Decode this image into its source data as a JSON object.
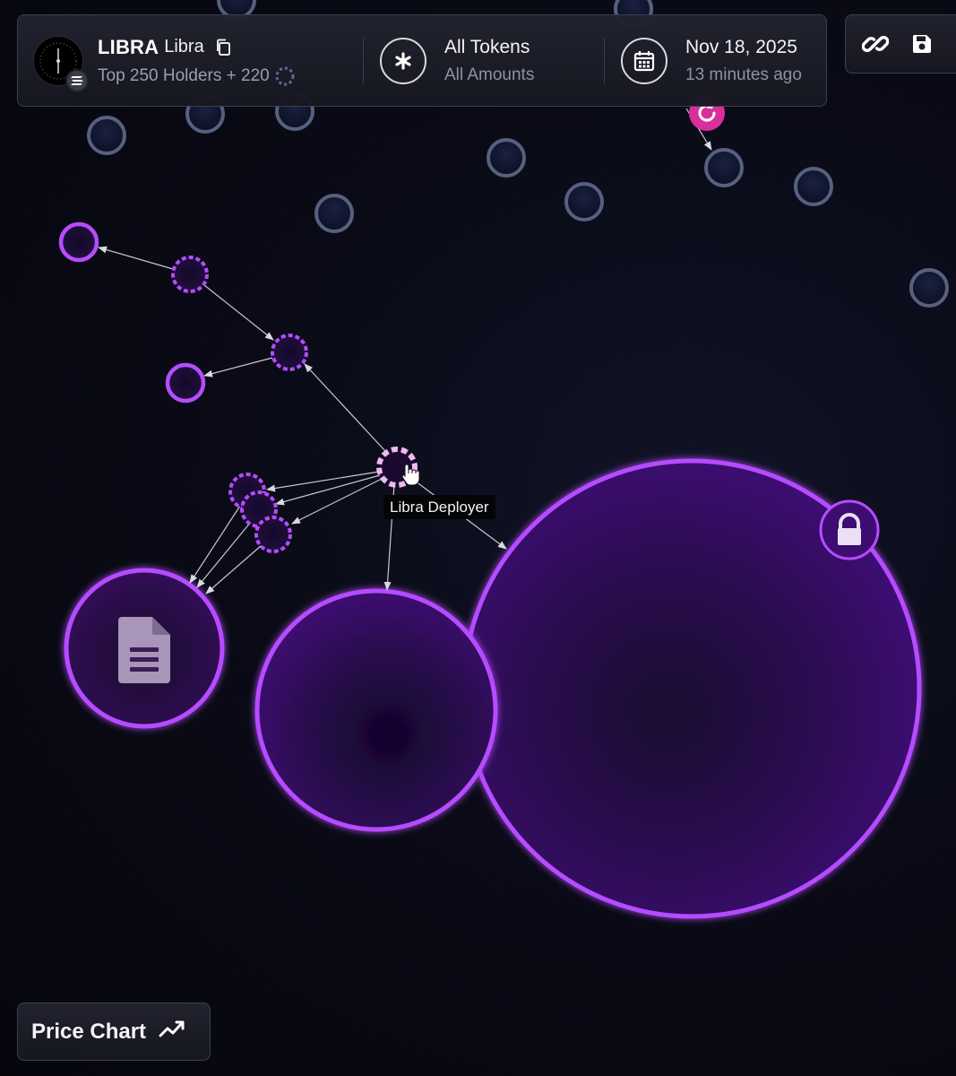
{
  "token": {
    "symbol": "LIBRA",
    "name": "Libra",
    "holders_summary": "Top 250 Holders + 220"
  },
  "filters": {
    "tokens_label": "All Tokens",
    "amounts_label": "All Amounts"
  },
  "snapshot": {
    "date": "Nov 18, 2025",
    "relative_time": "13 minutes ago"
  },
  "graph": {
    "hover_tooltip": "Libra Deployer"
  },
  "bottom_bar": {
    "price_chart_label": "Price Chart"
  },
  "icons": {
    "copy": "copy-icon",
    "filter": "asterisk-icon",
    "calendar": "calendar-icon",
    "link": "link-icon",
    "save": "save-icon",
    "refresh": "refresh-icon",
    "lock": "lock-icon",
    "document": "document-icon",
    "trend": "trend-line-icon"
  },
  "colors": {
    "accent_purple": "#b44dff",
    "node_grey_border": "#56607f",
    "refresh_badge": "#d82f9c",
    "background": "#07070e"
  }
}
